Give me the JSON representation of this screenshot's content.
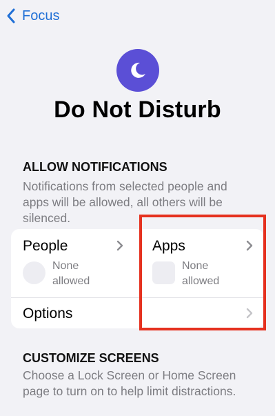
{
  "nav": {
    "back_label": "Focus",
    "back_icon": "chevron-left-icon",
    "accent": "#1f6fd6"
  },
  "header": {
    "icon": "moon-icon",
    "icon_color": "#5b4fd6",
    "title": "Do Not Disturb"
  },
  "allow_notifications": {
    "header": "ALLOW NOTIFICATIONS",
    "description": "Notifications from selected people and apps will be allowed, all others will be silenced."
  },
  "allow_card": {
    "people": {
      "label": "People",
      "status_line1": "None",
      "status_line2": "allowed"
    },
    "apps": {
      "label": "Apps",
      "status_line1": "None",
      "status_line2": "allowed"
    },
    "options": {
      "label": "Options"
    }
  },
  "customize_screens": {
    "header": "CUSTOMIZE SCREENS",
    "description": "Choose a Lock Screen or Home Screen page to turn on to help limit distractions."
  },
  "annotation": {
    "highlight_color": "#e5311f"
  }
}
